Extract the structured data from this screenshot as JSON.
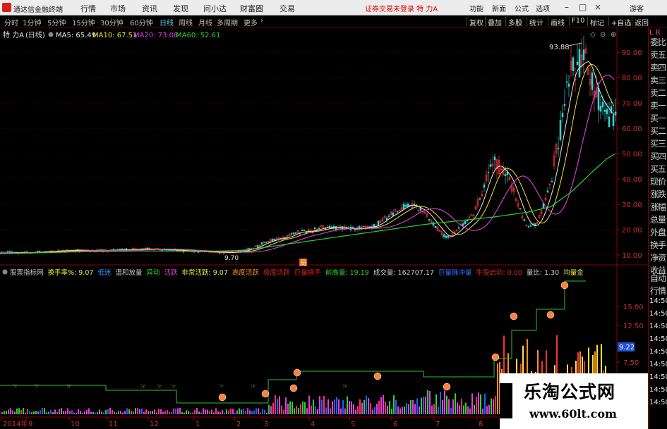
{
  "app": {
    "title": "通达信金融终端"
  },
  "menu": [
    "行情",
    "市场",
    "资讯",
    "发现",
    "问小达",
    "财富圈",
    "交易"
  ],
  "alert": "证券交易未登录 特 力A",
  "menu_right": [
    "功能",
    "新面",
    "公式",
    "选项"
  ],
  "user": "游客",
  "tabs": [
    "分时",
    "1分钟",
    "5分钟",
    "15分钟",
    "30分钟",
    "60分钟",
    "日线",
    "周线",
    "月线",
    "多周期",
    "更多"
  ],
  "active_tab": "日线",
  "right_buttons": [
    "复权",
    "叠加",
    "多股",
    "统计",
    "画线",
    "F10",
    "标记",
    "+自选",
    "返回"
  ],
  "stock": {
    "name": "特 力A",
    "period": "(日线)"
  },
  "ma": [
    {
      "label": "MA5: 65.49",
      "color": "#e8e8e8"
    },
    {
      "label": "MA10: 67.51",
      "color": "#f0e040"
    },
    {
      "label": "MA20: 73.08",
      "color": "#e040e0"
    },
    {
      "label": "MA60: 52.61",
      "color": "#30d030"
    }
  ],
  "price_axis": [
    "90.00",
    "80.00",
    "70.00",
    "60.00",
    "50.00",
    "40.00",
    "30.00",
    "20.00",
    "10.00"
  ],
  "annotations": {
    "high": "93.88",
    "low": "9.70",
    "marker": "局"
  },
  "indicator_bar": [
    {
      "text": "股票指标网",
      "color": "#c8c8c8"
    },
    {
      "text": "换手率%: 9.07",
      "color": "#f0f040"
    },
    {
      "text": "低迷",
      "color": "#3090ff"
    },
    {
      "text": "温和放量",
      "color": "#c8c8c8"
    },
    {
      "text": "异动",
      "color": "#30d030"
    },
    {
      "text": "活跃",
      "color": "#e040e0"
    },
    {
      "text": "非常活跃: 9.07",
      "color": "#f0f040"
    },
    {
      "text": "高度活跃",
      "color": "#ff9020"
    },
    {
      "text": "极度活跃",
      "color": "#e02020"
    },
    {
      "text": "巨量换手",
      "color": "#e02020"
    },
    {
      "text": "前高量: 19.19",
      "color": "#30d030"
    },
    {
      "text": "成交量: 162707.17",
      "color": "#c8c8c8"
    },
    {
      "text": "巨量脉冲量",
      "color": "#3070ff"
    },
    {
      "text": "牛股启动: 0.00",
      "color": "#e02020"
    },
    {
      "text": "量比: 1.30",
      "color": "#c8c8c8"
    },
    {
      "text": "均量金",
      "color": "#f0f040"
    }
  ],
  "vol_axis": [
    "15.00",
    "12.50",
    "7.50"
  ],
  "vol_current": "9.22",
  "x_axis": [
    "2014年",
    "9",
    "10",
    "11",
    "12",
    "1",
    "2",
    "3",
    "4",
    "5",
    "6",
    "7",
    "8"
  ],
  "side_panel": {
    "top": "L R",
    "items": [
      "委比",
      "卖五",
      "卖四",
      "卖三",
      "卖二",
      "卖一",
      "买一",
      "买二",
      "买三",
      "买四",
      "买五",
      "现价",
      "涨跌",
      "涨幅",
      "总量",
      "外盘",
      "换手",
      "净资",
      "收益"
    ],
    "bottom": [
      "自动",
      "行情"
    ],
    "times": [
      "14:50",
      "14:50",
      "14:50",
      "14:50",
      "14:50",
      "14:50",
      "14:50",
      "14:50",
      "14:50"
    ]
  },
  "watermark": {
    "title": "乐淘公式网",
    "url": "www.60lt.com"
  },
  "chart_data": {
    "type": "candlestick+line",
    "price_range": [
      10,
      90
    ],
    "x_labels": [
      "2014年",
      "9",
      "10",
      "11",
      "12",
      "1",
      "2",
      "3",
      "4",
      "5",
      "6",
      "7",
      "8"
    ],
    "price_path": [
      [
        0,
        10.8
      ],
      [
        20,
        11.0
      ],
      [
        40,
        10.9
      ],
      [
        60,
        11.3
      ],
      [
        80,
        11.6
      ],
      [
        100,
        11.9
      ],
      [
        120,
        11.7
      ],
      [
        140,
        11.8
      ],
      [
        160,
        11.9
      ],
      [
        180,
        12.1
      ],
      [
        200,
        12.4
      ],
      [
        220,
        12.3
      ],
      [
        240,
        12.0
      ],
      [
        260,
        11.6
      ],
      [
        280,
        11.4
      ],
      [
        300,
        11.2
      ],
      [
        320,
        10.9
      ],
      [
        340,
        11.4
      ],
      [
        360,
        13.0
      ],
      [
        375,
        15.0
      ],
      [
        390,
        16.3
      ],
      [
        405,
        17.0
      ],
      [
        415,
        18.5
      ],
      [
        425,
        19.2
      ],
      [
        440,
        19.5
      ],
      [
        455,
        20.8
      ],
      [
        470,
        20.7
      ],
      [
        485,
        20.6
      ],
      [
        500,
        20.2
      ],
      [
        515,
        20.8
      ],
      [
        530,
        21.5
      ],
      [
        545,
        24.5
      ],
      [
        560,
        27.0
      ],
      [
        570,
        29.0
      ],
      [
        580,
        30.0
      ],
      [
        590,
        28.5
      ],
      [
        600,
        27.0
      ],
      [
        610,
        23.5
      ],
      [
        620,
        20.0
      ],
      [
        630,
        17.0
      ],
      [
        640,
        18.0
      ],
      [
        650,
        21.0
      ],
      [
        660,
        23.0
      ],
      [
        670,
        26.0
      ],
      [
        680,
        33.0
      ],
      [
        690,
        42.0
      ],
      [
        700,
        46.0
      ],
      [
        710,
        43.5
      ],
      [
        720,
        40.0
      ],
      [
        730,
        32.0
      ],
      [
        738,
        26.0
      ],
      [
        745,
        22.0
      ],
      [
        752,
        21.0
      ],
      [
        760,
        23.0
      ],
      [
        770,
        30.0
      ],
      [
        780,
        40.0
      ],
      [
        790,
        55.0
      ],
      [
        800,
        70.0
      ],
      [
        808,
        83.0
      ],
      [
        815,
        84.0
      ],
      [
        822,
        86.0
      ],
      [
        830,
        87.0
      ],
      [
        838,
        78.0
      ],
      [
        845,
        72.0
      ],
      [
        855,
        68.0
      ],
      [
        865,
        64.0
      ],
      [
        872,
        66.0
      ]
    ],
    "ma60_path": [
      [
        0,
        10.5
      ],
      [
        100,
        11.2
      ],
      [
        200,
        11.6
      ],
      [
        300,
        11.5
      ],
      [
        345,
        11.8
      ],
      [
        400,
        14.0
      ],
      [
        500,
        18.0
      ],
      [
        600,
        22.0
      ],
      [
        700,
        25.0
      ],
      [
        750,
        27.0
      ],
      [
        780,
        29.0
      ],
      [
        810,
        35.0
      ],
      [
        840,
        43.0
      ],
      [
        860,
        48.0
      ],
      [
        872,
        50.0
      ]
    ],
    "volume_blocks": [
      {
        "from": 0,
        "to": 380,
        "amp": 8
      },
      {
        "from": 380,
        "to": 600,
        "amp": 24
      },
      {
        "from": 600,
        "to": 700,
        "amp": 30
      },
      {
        "from": 700,
        "to": 872,
        "amp": 62
      }
    ]
  }
}
